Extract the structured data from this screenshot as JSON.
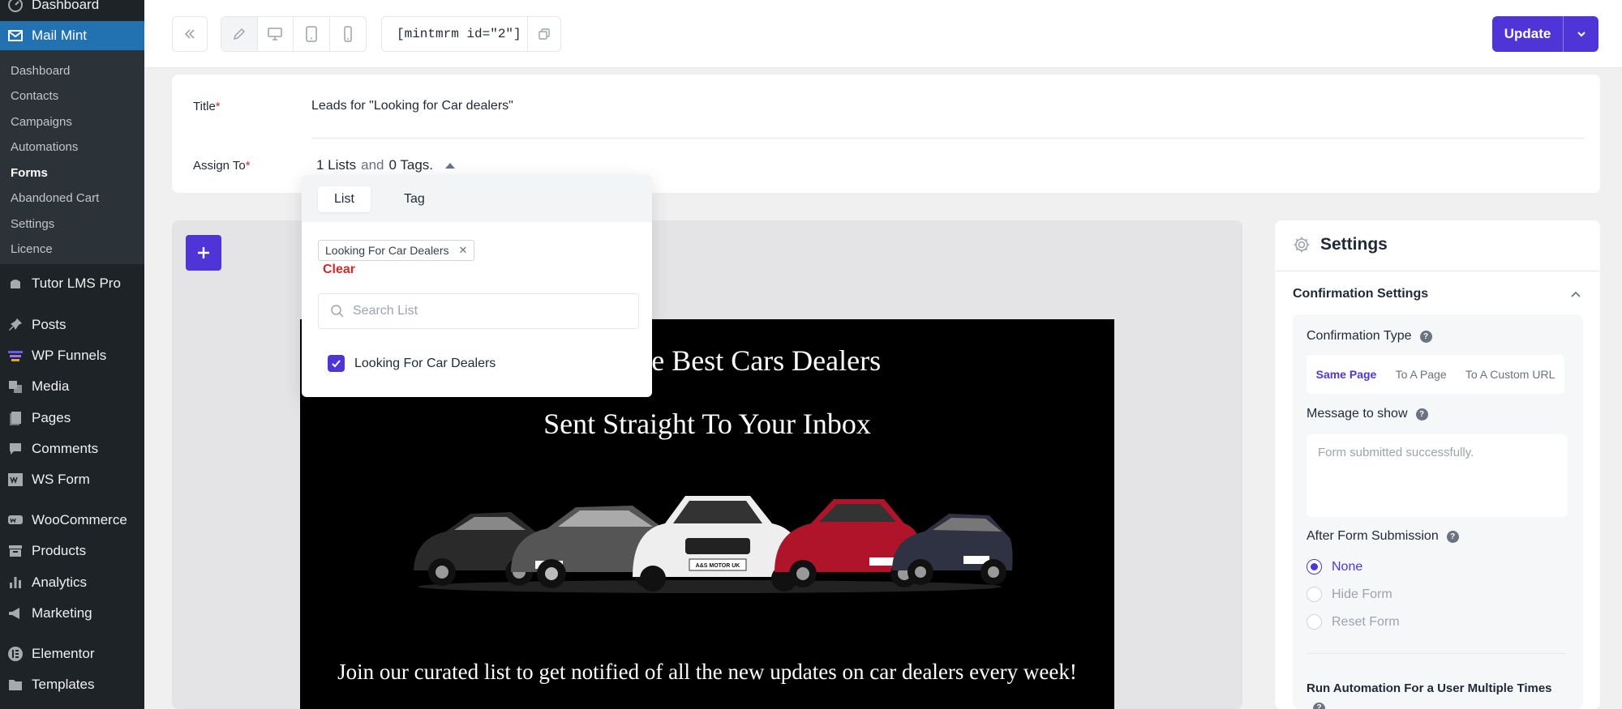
{
  "sidebar": {
    "top_items": [
      {
        "label": "Dashboard",
        "icon": "dashboard-icon"
      },
      {
        "label": "Mail Mint",
        "icon": "mail-icon"
      }
    ],
    "submenu": [
      "Dashboard",
      "Contacts",
      "Campaigns",
      "Automations",
      "Forms",
      "Abandoned Cart",
      "Settings",
      "Licence"
    ],
    "active_submenu": "Forms",
    "items": [
      {
        "label": "Tutor LMS Pro",
        "icon": "tutor-icon"
      },
      {
        "label": "Posts",
        "icon": "pin-icon"
      },
      {
        "label": "WP Funnels",
        "icon": "funnel-icon"
      },
      {
        "label": "Media",
        "icon": "media-icon"
      },
      {
        "label": "Pages",
        "icon": "pages-icon"
      },
      {
        "label": "Comments",
        "icon": "comment-icon"
      },
      {
        "label": "WS Form",
        "icon": "wsform-icon"
      },
      {
        "label": "WooCommerce",
        "icon": "woo-icon"
      },
      {
        "label": "Products",
        "icon": "archive-icon"
      },
      {
        "label": "Analytics",
        "icon": "bar-chart-icon"
      },
      {
        "label": "Marketing",
        "icon": "megaphone-icon"
      },
      {
        "label": "Elementor",
        "icon": "elementor-icon"
      },
      {
        "label": "Templates",
        "icon": "folder-icon"
      }
    ]
  },
  "toolbar": {
    "shortcode": "[mintmrm id=\"2\"]",
    "update_label": "Update"
  },
  "form": {
    "title_label": "Title",
    "title_value": "Leads for \"Looking for Car dealers\"",
    "assign_label": "Assign To",
    "assign_lists": "1 Lists",
    "assign_and": "and",
    "assign_tags": "0 Tags."
  },
  "dropdown": {
    "tabs": [
      "List",
      "Tag"
    ],
    "selected_chip": "Looking For Car Dealers",
    "clear_label": "Clear",
    "search_placeholder": "Search List",
    "option_label": "Looking For Car Dealers"
  },
  "canvas": {
    "headline_1": "On All The Best Cars Dealers",
    "headline_2": "Sent Straight To Your Inbox",
    "plate_text": "A&S MOTOR UK",
    "tagline": "Join our curated list to get notified of all the new updates on car dealers every week!"
  },
  "settings": {
    "title": "Settings",
    "section_title": "Confirmation Settings",
    "confirmation_type_label": "Confirmation Type",
    "confirmation_types": [
      "Same Page",
      "To A Page",
      "To A Custom URL"
    ],
    "message_label": "Message to show",
    "message_placeholder": "Form submitted successfully.",
    "after_submit_label": "After Form Submission",
    "after_submit_options": [
      "None",
      "Hide Form",
      "Reset Form"
    ],
    "run_automation_label": "Run Automation For a User Multiple Times"
  },
  "colors": {
    "accent": "#4f35d8",
    "wp_sidebar": "#1d2327",
    "wp_active": "#2271b1",
    "required": "#dc2626"
  }
}
